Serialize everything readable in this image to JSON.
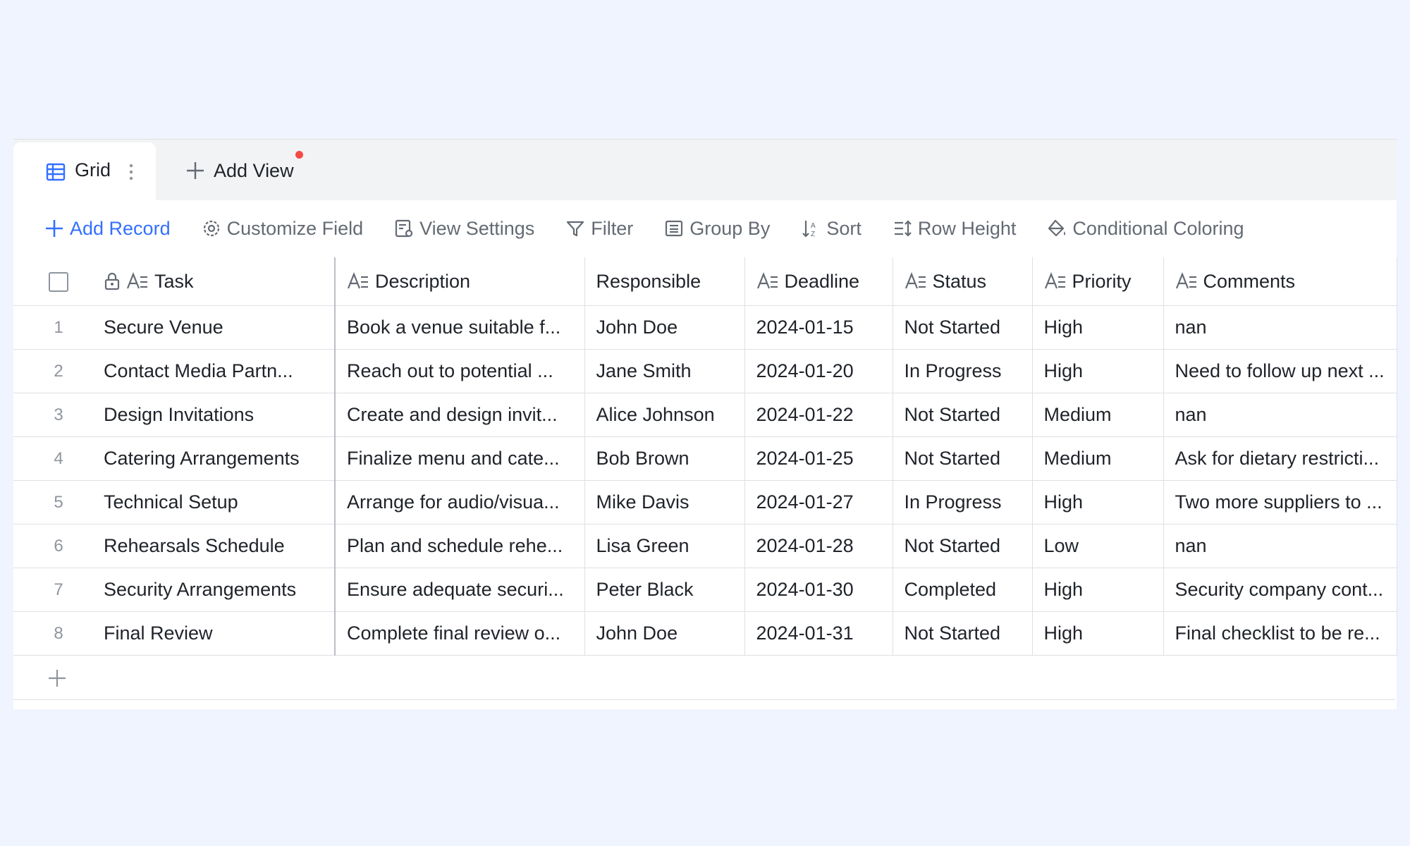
{
  "tabs": {
    "active_label": "Grid",
    "add_view_label": "Add View"
  },
  "toolbar": {
    "add_record": "Add Record",
    "customize_field": "Customize Field",
    "view_settings": "View Settings",
    "filter": "Filter",
    "group_by": "Group By",
    "sort": "Sort",
    "row_height": "Row Height",
    "conditional_coloring": "Conditional Coloring"
  },
  "columns": {
    "task": "Task",
    "description": "Description",
    "responsible": "Responsible",
    "deadline": "Deadline",
    "status": "Status",
    "priority": "Priority",
    "comments": "Comments"
  },
  "rows": [
    {
      "num": "1",
      "task": "Secure Venue",
      "description": "Book a venue suitable f...",
      "responsible": "John Doe",
      "deadline": "2024-01-15",
      "status": "Not Started",
      "priority": "High",
      "comments": "nan"
    },
    {
      "num": "2",
      "task": "Contact Media Partn...",
      "description": "Reach out to potential ...",
      "responsible": "Jane Smith",
      "deadline": "2024-01-20",
      "status": "In Progress",
      "priority": "High",
      "comments": "Need to follow up next ..."
    },
    {
      "num": "3",
      "task": "Design Invitations",
      "description": "Create and design invit...",
      "responsible": "Alice Johnson",
      "deadline": "2024-01-22",
      "status": "Not Started",
      "priority": "Medium",
      "comments": "nan"
    },
    {
      "num": "4",
      "task": "Catering Arrangements",
      "description": "Finalize menu and cate...",
      "responsible": "Bob Brown",
      "deadline": "2024-01-25",
      "status": "Not Started",
      "priority": "Medium",
      "comments": "Ask for dietary restricti..."
    },
    {
      "num": "5",
      "task": "Technical Setup",
      "description": "Arrange for audio/visua...",
      "responsible": "Mike Davis",
      "deadline": "2024-01-27",
      "status": "In Progress",
      "priority": "High",
      "comments": "Two more suppliers to ..."
    },
    {
      "num": "6",
      "task": "Rehearsals Schedule",
      "description": "Plan and schedule rehe...",
      "responsible": "Lisa Green",
      "deadline": "2024-01-28",
      "status": "Not Started",
      "priority": "Low",
      "comments": "nan"
    },
    {
      "num": "7",
      "task": "Security Arrangements",
      "description": "Ensure adequate securi...",
      "responsible": "Peter Black",
      "deadline": "2024-01-30",
      "status": "Completed",
      "priority": "High",
      "comments": "Security company cont..."
    },
    {
      "num": "8",
      "task": "Final Review",
      "description": "Complete final review o...",
      "responsible": "John Doe",
      "deadline": "2024-01-31",
      "status": "Not Started",
      "priority": "High",
      "comments": "Final checklist to be re..."
    }
  ],
  "colors": {
    "accent": "#3370ff",
    "page_bg": "#eff4fe",
    "notification": "#f54a45"
  }
}
